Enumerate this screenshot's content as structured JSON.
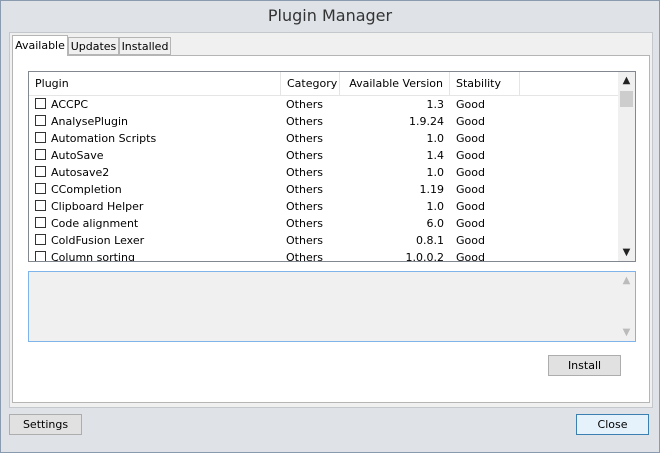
{
  "window": {
    "title": "Plugin Manager"
  },
  "tabs": [
    {
      "label": "Available",
      "active": true
    },
    {
      "label": "Updates",
      "active": false
    },
    {
      "label": "Installed",
      "active": false
    }
  ],
  "list": {
    "columns": [
      "Plugin",
      "Category",
      "Available Version",
      "Stability"
    ],
    "rows": [
      {
        "name": "ACCPC",
        "category": "Others",
        "version": "1.3",
        "stability": "Good"
      },
      {
        "name": "AnalysePlugin",
        "category": "Others",
        "version": "1.9.24",
        "stability": "Good"
      },
      {
        "name": "Automation Scripts",
        "category": "Others",
        "version": "1.0",
        "stability": "Good"
      },
      {
        "name": "AutoSave",
        "category": "Others",
        "version": "1.4",
        "stability": "Good"
      },
      {
        "name": "Autosave2",
        "category": "Others",
        "version": "1.0",
        "stability": "Good"
      },
      {
        "name": "CCompletion",
        "category": "Others",
        "version": "1.19",
        "stability": "Good"
      },
      {
        "name": "Clipboard Helper",
        "category": "Others",
        "version": "1.0",
        "stability": "Good"
      },
      {
        "name": "Code alignment",
        "category": "Others",
        "version": "6.0",
        "stability": "Good"
      },
      {
        "name": "ColdFusion Lexer",
        "category": "Others",
        "version": "0.8.1",
        "stability": "Good"
      },
      {
        "name": "Column sorting",
        "category": "Others",
        "version": "1.0.0.2",
        "stability": "Good"
      }
    ]
  },
  "description": {
    "text": ""
  },
  "buttons": {
    "install": "Install",
    "settings": "Settings",
    "close": "Close"
  },
  "icons": {
    "scroll_up": "▲",
    "scroll_down": "▼"
  }
}
